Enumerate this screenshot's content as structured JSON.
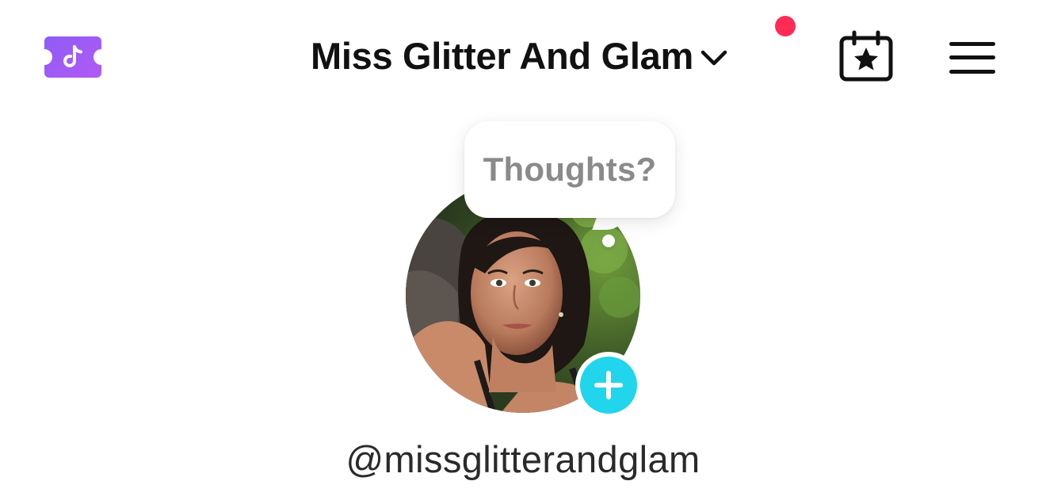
{
  "header": {
    "account_name": "Miss Glitter And Glam",
    "notification_dot_color": "#fe2c55",
    "left_icon": "tiktok-ticket-icon",
    "dropdown_icon": "chevron-down-icon",
    "calendar_icon": "calendar-star-icon",
    "menu_icon": "hamburger-menu-icon"
  },
  "profile": {
    "thought_bubble_text": "Thoughts?",
    "username": "@missglitterandglam",
    "avatar_alt": "profile-photo",
    "add_story_icon": "plus-icon",
    "add_story_color": "#20d5ec"
  },
  "colors": {
    "ticket_purple_start": "#8b5cf6",
    "ticket_purple_end": "#a855f7",
    "text_primary": "#111111",
    "bubble_text": "#8a8a8a"
  }
}
